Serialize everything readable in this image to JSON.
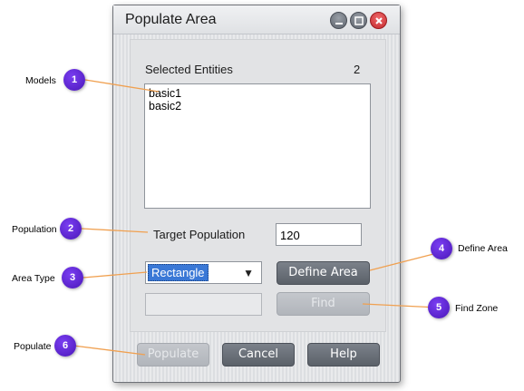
{
  "window": {
    "title": "Populate Area",
    "controls": [
      "minimize-icon",
      "maximize-icon",
      "close-icon"
    ]
  },
  "selected_entities": {
    "label": "Selected Entities",
    "count": "2",
    "items": [
      "basic1",
      "basic2"
    ]
  },
  "target_population": {
    "label": "Target Population",
    "value": "120"
  },
  "area_type": {
    "selected": "Rectangle",
    "arrow": "▼"
  },
  "buttons": {
    "define_area": "Define Area",
    "find": "Find",
    "populate": "Populate",
    "cancel": "Cancel",
    "help": "Help"
  },
  "callouts": [
    {
      "num": "1",
      "label": "Models"
    },
    {
      "num": "2",
      "label": "Population"
    },
    {
      "num": "3",
      "label": "Area Type"
    },
    {
      "num": "4",
      "label": "Define Area"
    },
    {
      "num": "5",
      "label": "Find Zone"
    },
    {
      "num": "6",
      "label": "Populate"
    }
  ],
  "colors": {
    "callout": "#5a22d4",
    "leader_line": "#f0a050",
    "button": "#666c75",
    "selection": "#3a78d6"
  }
}
